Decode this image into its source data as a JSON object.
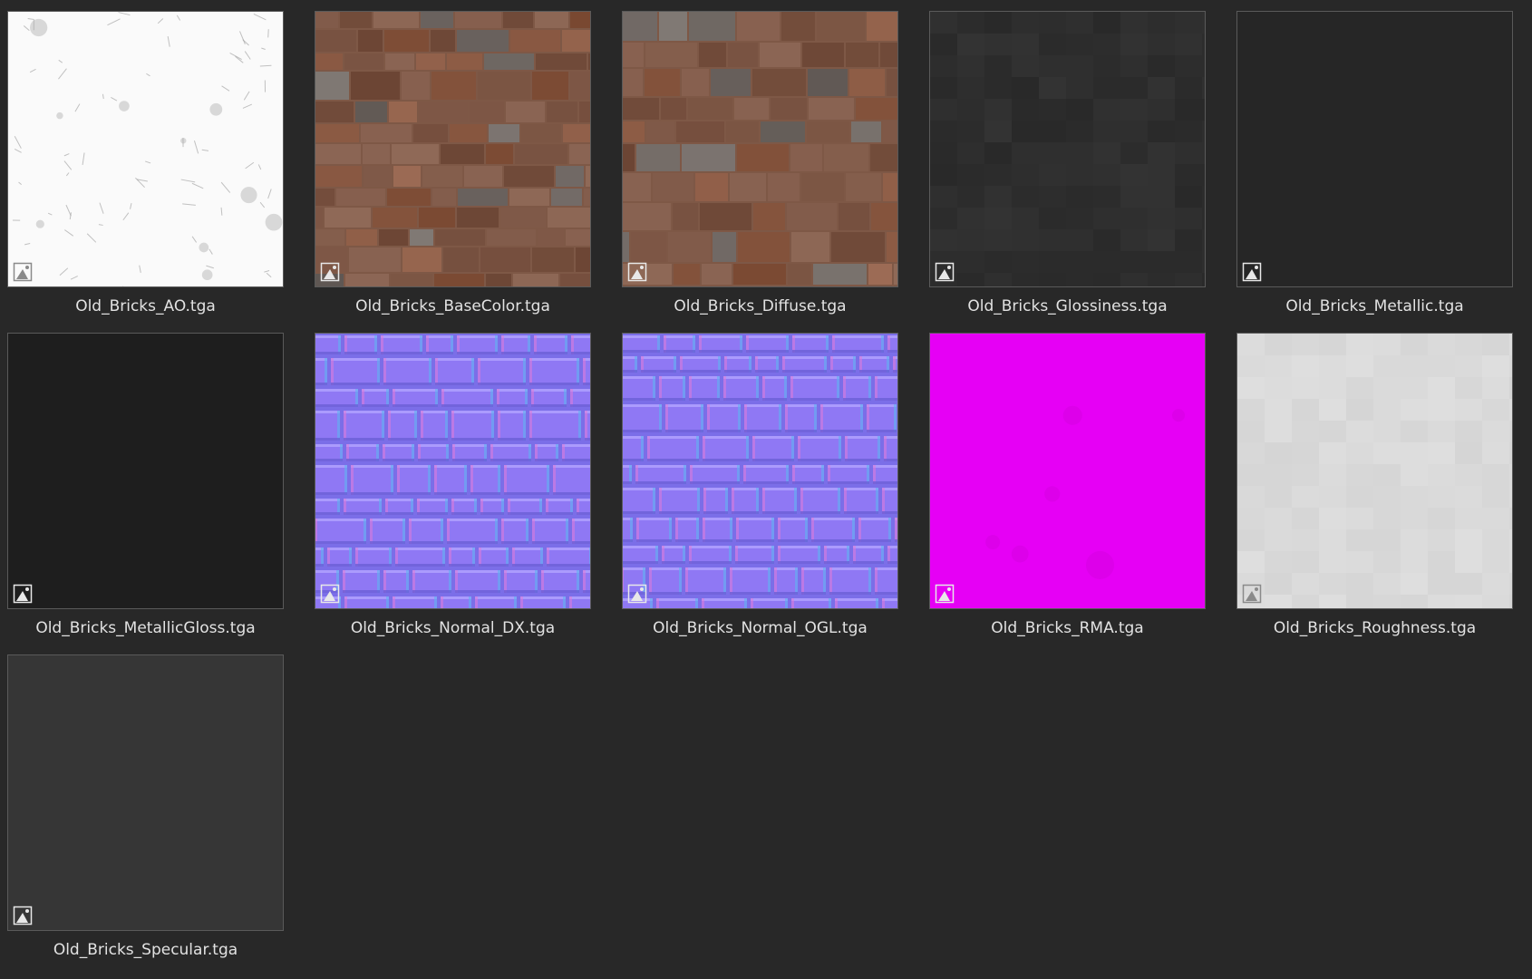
{
  "files": [
    {
      "name": "Old_Bricks_AO.tga",
      "kind": "ao",
      "base_color": "#fafafa"
    },
    {
      "name": "Old_Bricks_BaseColor.tga",
      "kind": "brick",
      "base_color": "#7e5846"
    },
    {
      "name": "Old_Bricks_Diffuse.tga",
      "kind": "brick",
      "base_color": "#7e5846"
    },
    {
      "name": "Old_Bricks_Glossiness.tga",
      "kind": "dark-noise",
      "base_color": "#2e2e2e"
    },
    {
      "name": "Old_Bricks_Metallic.tga",
      "kind": "flat",
      "base_color": "#262626"
    },
    {
      "name": "Old_Bricks_MetallicGloss.tga",
      "kind": "flat",
      "base_color": "#1e1e1e"
    },
    {
      "name": "Old_Bricks_Normal_DX.tga",
      "kind": "normal",
      "base_color": "#8a6cf0"
    },
    {
      "name": "Old_Bricks_Normal_OGL.tga",
      "kind": "normal",
      "base_color": "#8a6cf0"
    },
    {
      "name": "Old_Bricks_RMA.tga",
      "kind": "magenta",
      "base_color": "#e600f5"
    },
    {
      "name": "Old_Bricks_Roughness.tga",
      "kind": "light-noise",
      "base_color": "#d9d9d9"
    },
    {
      "name": "Old_Bricks_Specular.tga",
      "kind": "flat",
      "base_color": "#363636"
    }
  ],
  "icon": "image-file-icon"
}
